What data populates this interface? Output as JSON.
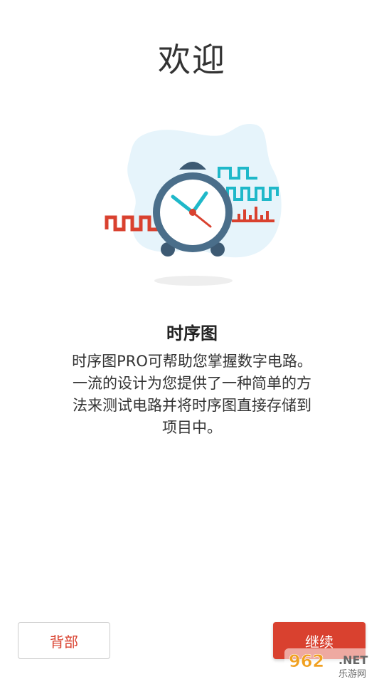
{
  "header": {
    "title": "欢迎"
  },
  "intro": {
    "heading": "时序图",
    "description_lines": [
      "时序图PRO可帮助您掌握数字电路。",
      "一流的设计为您提供了一种简单的方",
      "法来测试电路并将时序图直接存储到",
      "项目中。"
    ]
  },
  "buttons": {
    "back_label": "背部",
    "next_label": "继续"
  },
  "watermark": {
    "number": "962",
    "suffix": ".NET",
    "caption": "乐游网"
  },
  "colors": {
    "accent": "#d9412f",
    "teal": "#1fb8c9",
    "clock_body": "#4a6e8a",
    "blob": "#e6f4fb"
  },
  "illustration": {
    "icon": "alarm-clock-icon"
  }
}
